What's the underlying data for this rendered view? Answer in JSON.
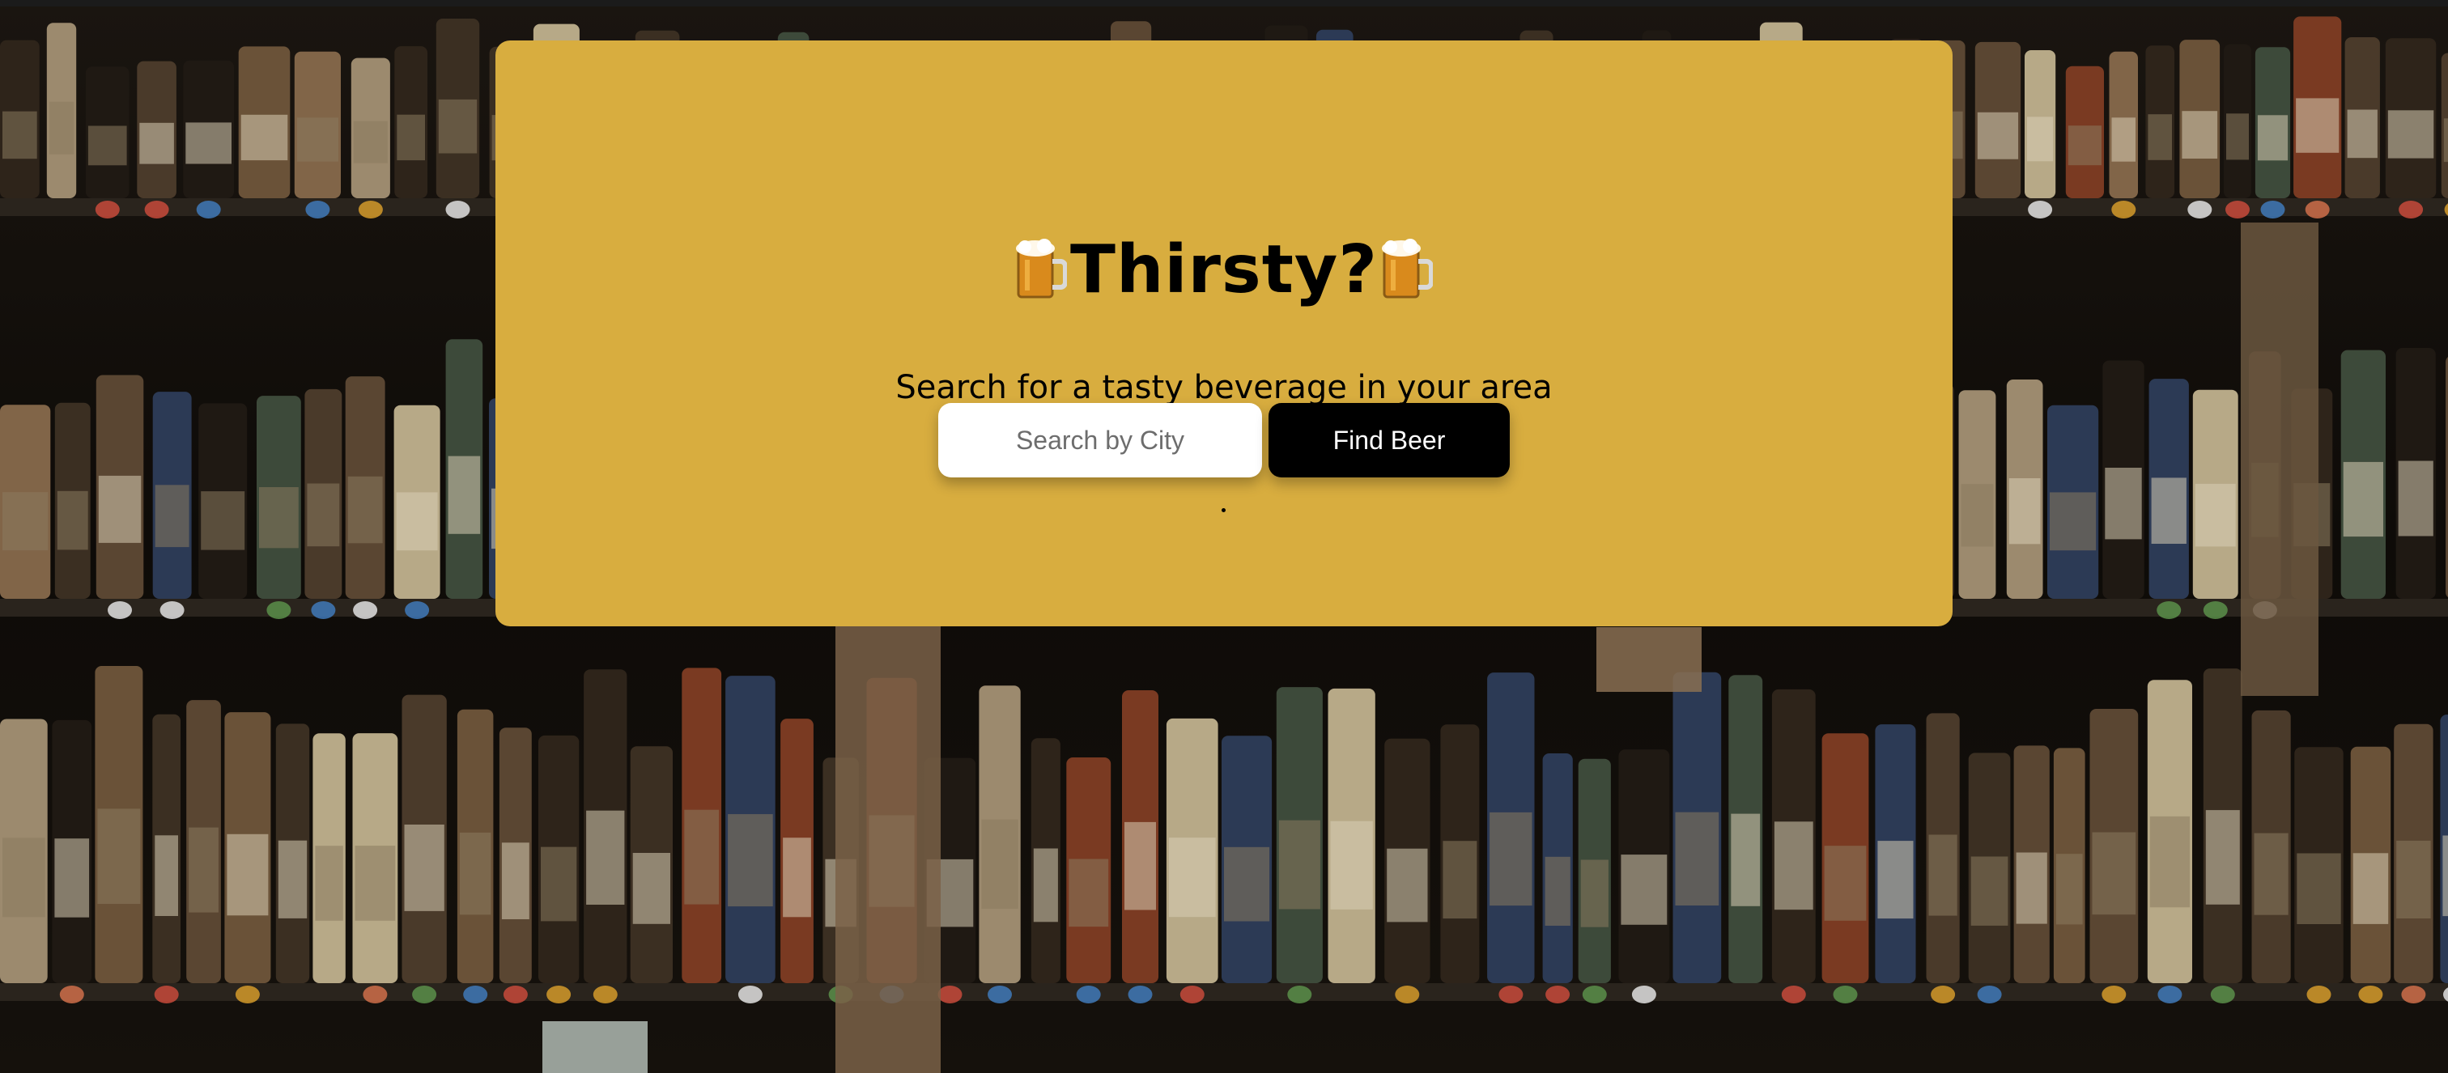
{
  "hero": {
    "title": "Thirsty?",
    "subtitle": "Search for a tasty beverage in your area",
    "search": {
      "placeholder": "Search by City",
      "value": ""
    },
    "button_label": "Find Beer",
    "status_text": "."
  },
  "icons": {
    "title_left": "beer-mug-icon",
    "title_right": "beer-mug-icon"
  },
  "colors": {
    "card_background": "#d8ad3f",
    "button_background": "#000000",
    "button_text": "#ffffff",
    "input_background": "#ffffff",
    "page_background": "#0b0907"
  }
}
